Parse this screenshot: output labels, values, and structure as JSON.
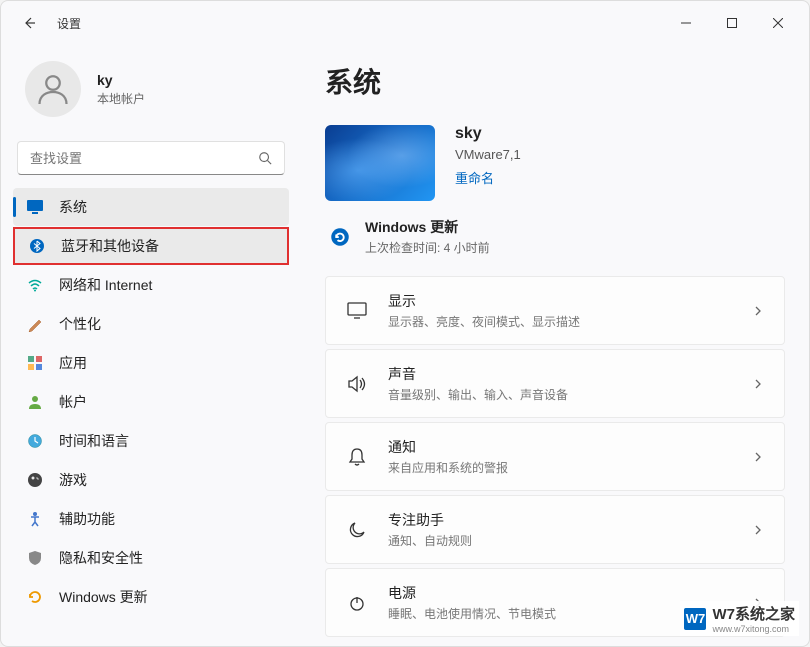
{
  "app": {
    "title": "设置"
  },
  "user": {
    "name": "ky",
    "type": "本地帐户"
  },
  "search": {
    "placeholder": "查找设置"
  },
  "sidebar": {
    "items": [
      {
        "label": "系统",
        "icon": "system",
        "active": true
      },
      {
        "label": "蓝牙和其他设备",
        "icon": "bluetooth",
        "highlighted": true
      },
      {
        "label": "网络和 Internet",
        "icon": "network"
      },
      {
        "label": "个性化",
        "icon": "personalize"
      },
      {
        "label": "应用",
        "icon": "apps"
      },
      {
        "label": "帐户",
        "icon": "accounts"
      },
      {
        "label": "时间和语言",
        "icon": "time"
      },
      {
        "label": "游戏",
        "icon": "gaming"
      },
      {
        "label": "辅助功能",
        "icon": "accessibility"
      },
      {
        "label": "隐私和安全性",
        "icon": "privacy"
      },
      {
        "label": "Windows 更新",
        "icon": "update"
      }
    ]
  },
  "main": {
    "title": "系统",
    "device": {
      "name": "sky",
      "model": "VMware7,1",
      "rename": "重命名"
    },
    "update": {
      "title": "Windows 更新",
      "sub": "上次检查时间: 4 小时前"
    },
    "rows": [
      {
        "title": "显示",
        "sub": "显示器、亮度、夜间模式、显示描述",
        "icon": "display"
      },
      {
        "title": "声音",
        "sub": "音量级别、输出、输入、声音设备",
        "icon": "sound"
      },
      {
        "title": "通知",
        "sub": "来自应用和系统的警报",
        "icon": "notifications"
      },
      {
        "title": "专注助手",
        "sub": "通知、自动规则",
        "icon": "focus"
      },
      {
        "title": "电源",
        "sub": "睡眠、电池使用情况、节电模式",
        "icon": "power"
      }
    ]
  },
  "watermark": {
    "text": "W7系统之家",
    "sub": "www.w7xitong.com",
    "badge": "W7"
  }
}
